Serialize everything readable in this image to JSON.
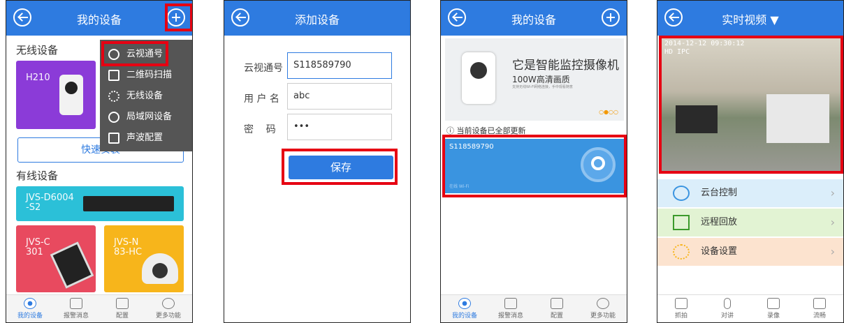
{
  "panel1": {
    "title": "我的设备",
    "wireless_header": "无线设备",
    "wired_header": "有线设备",
    "quick_install": "快速安装",
    "devices": [
      {
        "name": "H210",
        "color": "#8b3bd8"
      },
      {
        "name": "JVS-D6004\n-S2",
        "color": "#2bc0d8"
      },
      {
        "name": "JVS-C\n301",
        "color": "#e84a5f"
      },
      {
        "name": "JVS-N\n83-HC",
        "color": "#f7b51b"
      }
    ],
    "menu": {
      "items": [
        {
          "label": "云视通号",
          "icon": "cloud-id-icon"
        },
        {
          "label": "二维码扫描",
          "icon": "qr-code-icon"
        },
        {
          "label": "无线设备",
          "icon": "wifi-icon"
        },
        {
          "label": "局域网设备",
          "icon": "lan-icon"
        },
        {
          "label": "声波配置",
          "icon": "soundwave-icon"
        }
      ]
    },
    "tabs": [
      {
        "label": "我的设备",
        "icon": "device-icon"
      },
      {
        "label": "报警消息",
        "icon": "message-icon"
      },
      {
        "label": "配置",
        "icon": "settings-icon"
      },
      {
        "label": "更多功能",
        "icon": "more-icon"
      }
    ]
  },
  "panel2": {
    "title": "添加设备",
    "fields": [
      {
        "label": "云视通号",
        "value": "S118589790"
      },
      {
        "label": "用 户 名",
        "value": "abc"
      },
      {
        "label": "密    码",
        "value": "•••"
      }
    ],
    "save_label": "保存"
  },
  "panel3": {
    "title": "我的设备",
    "banner_title": "它是智能监控摄像机",
    "banner_sub": "100W高清画质",
    "banner_small": "支持无线Wi-Fi网络连接，手中观看随意",
    "update_note": "当前设备已全部更新",
    "device_id": "S118589790",
    "device_sub": "在线 Wi-Fi",
    "tabs": [
      {
        "label": "我的设备"
      },
      {
        "label": "报警消息"
      },
      {
        "label": "配置"
      },
      {
        "label": "更多功能"
      }
    ]
  },
  "panel4": {
    "title": "实时视频",
    "timestamp": "2014-12-12 09:30:12",
    "camera_label": "HD IPC",
    "rows": [
      {
        "label": "云台控制",
        "icon": "ptz-icon",
        "bg": "#dbeefa"
      },
      {
        "label": "远程回放",
        "icon": "playback-icon",
        "bg": "#e2f3d3"
      },
      {
        "label": "设备设置",
        "icon": "sun-settings-icon",
        "bg": "#fce3cf"
      }
    ],
    "controls": [
      {
        "label": "抓拍",
        "icon": "camera-icon"
      },
      {
        "label": "对讲",
        "icon": "mic-icon"
      },
      {
        "label": "录像",
        "icon": "video-icon"
      },
      {
        "label": "流畅",
        "icon": "quality-icon"
      }
    ]
  }
}
